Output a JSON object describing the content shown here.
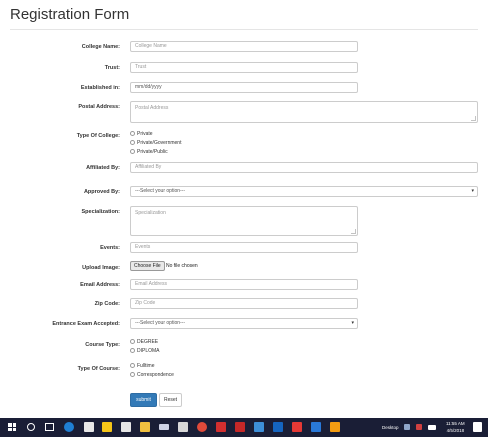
{
  "page": {
    "title": "Registration Form"
  },
  "form": {
    "college_name": {
      "label": "College Name:",
      "placeholder": "College Name"
    },
    "trust": {
      "label": "Trust:",
      "placeholder": "Trust"
    },
    "established": {
      "label": "Established in:",
      "value": "mm/dd/yyyy"
    },
    "postal_address": {
      "label": "Postal Address:",
      "placeholder": "Postal Address"
    },
    "type_of_college": {
      "label": "Type Of College:",
      "options": [
        "Private",
        "Private/Government",
        "Private/Public"
      ]
    },
    "affiliated_by": {
      "label": "Affiliated By:",
      "placeholder": "Affiliated By"
    },
    "approved_by": {
      "label": "Approved By:",
      "selected": "---Select your option---"
    },
    "specialization": {
      "label": "Specialization:",
      "placeholder": "Specialization"
    },
    "events": {
      "label": "Events:",
      "placeholder": "Events"
    },
    "upload_image": {
      "label": "Upload Image:",
      "button": "Choose File",
      "status": "No file chosen"
    },
    "email_address": {
      "label": "Email Address:",
      "placeholder": "Email Address"
    },
    "zip_code": {
      "label": "Zip Code:",
      "placeholder": "Zip Code"
    },
    "entrance_exam": {
      "label": "Entrance Exam Accepted:",
      "selected": "---Select your option---"
    },
    "course_type": {
      "label": "Course Type:",
      "options": [
        "DEGREE",
        "DIPLOMA"
      ]
    },
    "type_of_course": {
      "label": "Type Of Course:",
      "options": [
        "Fulltime",
        "Correspondence"
      ]
    },
    "submit_label": "submit",
    "reset_label": "Reset"
  },
  "taskbar": {
    "desktop_label": "Desktop",
    "time": "11:55 AM",
    "date": "4/5/2018",
    "accent": "#337ab7",
    "icons": [
      "windows-start-icon",
      "search-icon",
      "task-view-icon",
      "edge-icon",
      "mail-icon",
      "sticky-notes-icon",
      "store-icon",
      "file-explorer-icon",
      "keyboard-icon",
      "notes-app-icon",
      "chrome-icon",
      "pdf-icon",
      "terminal-icon",
      "network-app-icon",
      "outlook-icon",
      "photos-icon",
      "code-icon",
      "word-icon",
      "app-icon"
    ]
  }
}
